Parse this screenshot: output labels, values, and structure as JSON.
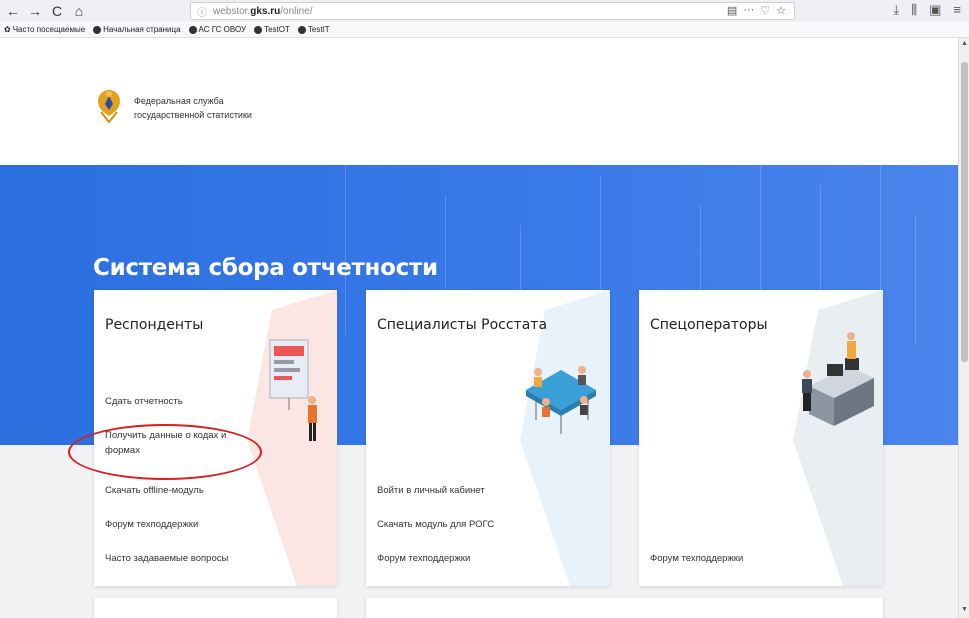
{
  "browser": {
    "url_prefix": "webstor.",
    "url_domain": "gks.ru",
    "url_path": "/online/",
    "nav": [
      "←",
      "→",
      "C",
      "⌂"
    ],
    "url_icons": [
      "▤",
      "···",
      "♡",
      "☆"
    ],
    "right_icons": [
      "⤓",
      "⫼",
      "▣",
      "≡"
    ],
    "bookmarks": [
      "Часто посещаемые",
      "Начальная страница",
      "АС ГС ОВОУ",
      "TestOT",
      "TestIT"
    ]
  },
  "header": {
    "org_line1": "Федеральная служба",
    "org_line2": "государственной статистики"
  },
  "hero": {
    "title": "Система сбора отчетности"
  },
  "cards": {
    "respondents": {
      "title": "Респонденты",
      "links": [
        "Сдать отчетность",
        "Получить данные о кодах и формах",
        "Скачать offline-модуль",
        "Форум техподдержки",
        "Часто задаваемые вопросы"
      ]
    },
    "specialists": {
      "title": "Специалисты Росстата",
      "links": [
        "Войти в личный кабинет",
        "Скачать модуль для РОГС",
        "Форум техподдержки"
      ]
    },
    "operators": {
      "title": "Спецоператоры",
      "links": [
        "Форум техподдержки"
      ]
    }
  },
  "colors": {
    "hero_blue": "#2b6fe0",
    "highlight_red": "#d81e1e"
  }
}
